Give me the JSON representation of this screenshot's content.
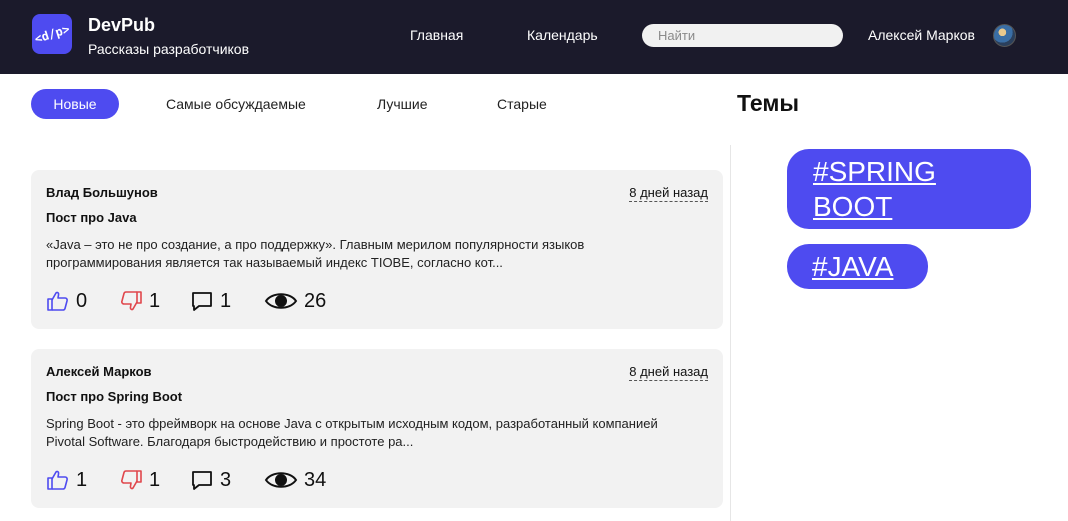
{
  "header": {
    "logo_text": "<d/p>",
    "brand_title": "DevPub",
    "brand_subtitle": "Рассказы разработчиков",
    "nav": [
      "Главная",
      "Календарь"
    ],
    "search": {
      "placeholder": "Найти",
      "value": ""
    },
    "user_name": "Алексей Марков"
  },
  "tabs": [
    "Новые",
    "Самые обсуждаемые",
    "Лучшие",
    "Старые"
  ],
  "active_tab": "Новые",
  "posts": [
    {
      "author": "Влад Большунов",
      "date": "8 дней назад",
      "title": "Пост про Java",
      "text": "«Java – это не про создание, а про поддержку». Главным мерилом популярности языков программирования является так называемый индекс TIOBE, согласно кот...",
      "likes": "0",
      "dislikes": "1",
      "comments": "1",
      "views": "26"
    },
    {
      "author": "Алексей Марков",
      "date": "8 дней назад",
      "title": "Пост про Spring Boot",
      "text": "Spring Boot - это фреймворк на основе Java с открытым исходным кодом, разработанный компанией Pivotal Software. Благодаря быстродействию и простоте ра...",
      "likes": "1",
      "dislikes": "1",
      "comments": "3",
      "views": "34"
    }
  ],
  "sidebar": {
    "title": "Темы",
    "tags": [
      "#SPRING BOOT",
      "#JAVA"
    ]
  },
  "colors": {
    "header_bg": "#1b1a2b",
    "accent": "#4e4bf0",
    "card_bg": "#f2f2f2",
    "like_icon": "#4e4bf0",
    "dislike_icon": "#e0474c"
  },
  "icons": {
    "like": "thumbs-up-icon",
    "dislike": "thumbs-down-icon",
    "comment": "comment-icon",
    "views": "eye-icon"
  }
}
